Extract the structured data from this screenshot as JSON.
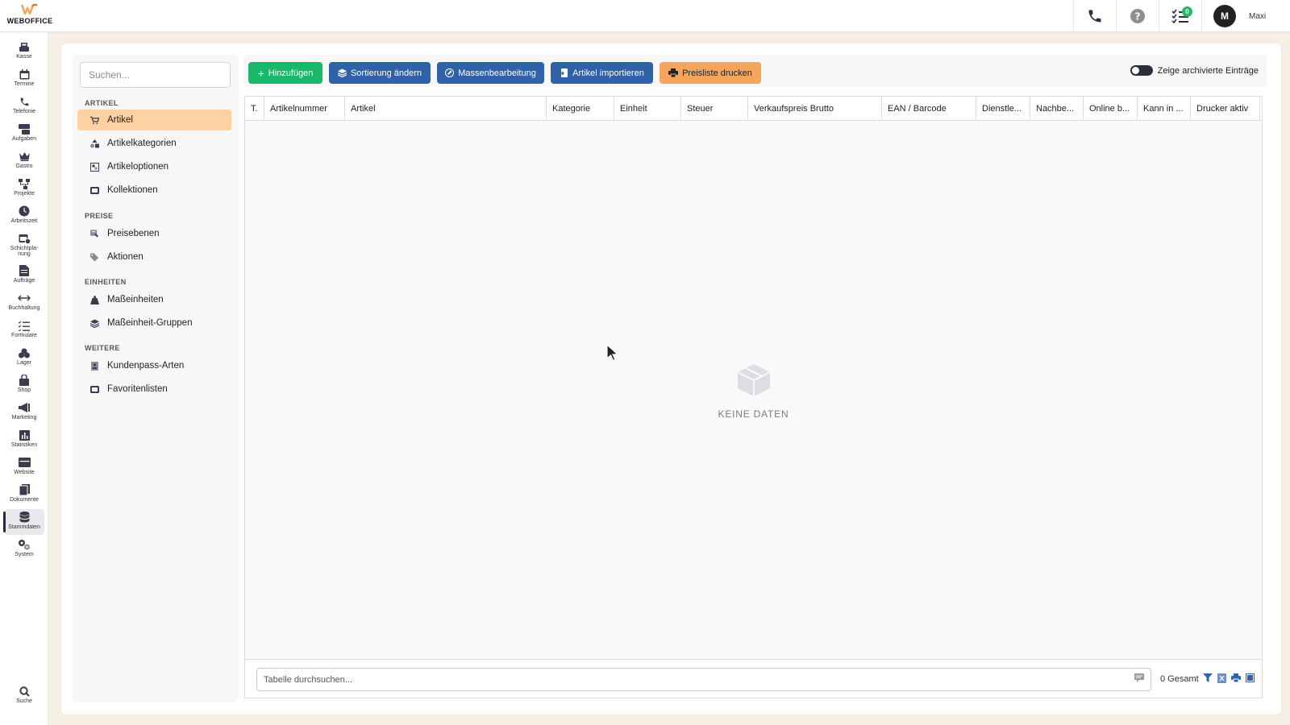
{
  "app": {
    "logo_text": "WEBOFFICE",
    "brand_color": "#f6a55c"
  },
  "topbar": {
    "task_badge": "0",
    "avatar_initial": "M",
    "user_name": "Maxi"
  },
  "leftnav": {
    "items": [
      {
        "label": "Kasse",
        "icon": "register-icon"
      },
      {
        "label": "Termine",
        "icon": "calendar-icon"
      },
      {
        "label": "Telefonie",
        "icon": "phone-icon"
      },
      {
        "label": "Aufgaben",
        "icon": "tasks-icon"
      },
      {
        "label": "Gastro",
        "icon": "crown-icon"
      },
      {
        "label": "Projekte",
        "icon": "projects-icon"
      },
      {
        "label": "Arbeitszeit",
        "icon": "clock-icon"
      },
      {
        "label": "Schichtpla-",
        "label2": "nung",
        "icon": "shift-icon"
      },
      {
        "label": "Aufträge",
        "icon": "document-icon"
      },
      {
        "label": "Buchhaltung",
        "icon": "arrows-icon"
      },
      {
        "label": "Formulare",
        "icon": "form-icon"
      },
      {
        "label": "Lager",
        "icon": "boxes-icon"
      },
      {
        "label": "Shop",
        "icon": "bag-icon"
      },
      {
        "label": "Marketing",
        "icon": "megaphone-icon"
      },
      {
        "label": "Statistiken",
        "icon": "chart-icon"
      },
      {
        "label": "Website",
        "icon": "browser-icon"
      },
      {
        "label": "Dokumente",
        "icon": "files-icon"
      },
      {
        "label": "Stammdaten",
        "icon": "database-icon",
        "active": true
      },
      {
        "label": "System",
        "icon": "gears-icon"
      }
    ],
    "search_label": "Suche"
  },
  "subsidebar": {
    "search_placeholder": "Suchen...",
    "sections": [
      {
        "title": "ARTIKEL",
        "items": [
          "Artikel",
          "Artikelkategorien",
          "Artikeloptionen",
          "Kollektionen"
        ]
      },
      {
        "title": "PREISE",
        "items": [
          "Preisebenen",
          "Aktionen"
        ]
      },
      {
        "title": "EINHEITEN",
        "items": [
          "Maßeinheiten",
          "Maßeinheit-Gruppen"
        ]
      },
      {
        "title": "WEITERE",
        "items": [
          "Kundenpass-Arten",
          "Favoritenlisten"
        ]
      }
    ],
    "active_item": "Artikel"
  },
  "toolbar": {
    "add": "Hinzufügen",
    "sort": "Sortierung ändern",
    "mass_edit": "Massenbearbeitung",
    "import": "Artikel importieren",
    "print_pricelist": "Preisliste drucken",
    "archived_toggle": "Zeige archivierte Einträge",
    "archived_toggle_on": false
  },
  "table": {
    "columns": [
      "T.",
      "Artikelnummer",
      "Artikel",
      "Kategorie",
      "Einheit",
      "Steuer",
      "Verkaufspreis Brutto",
      "EAN / Barcode",
      "Dienstle...",
      "Nachbe...",
      "Online b...",
      "Kann in ...",
      "Drucker aktiv"
    ],
    "rows": [],
    "empty_text": "KEINE DATEN"
  },
  "footer": {
    "search_placeholder": "Tabelle durchsuchen...",
    "total": "0 Gesamt"
  }
}
